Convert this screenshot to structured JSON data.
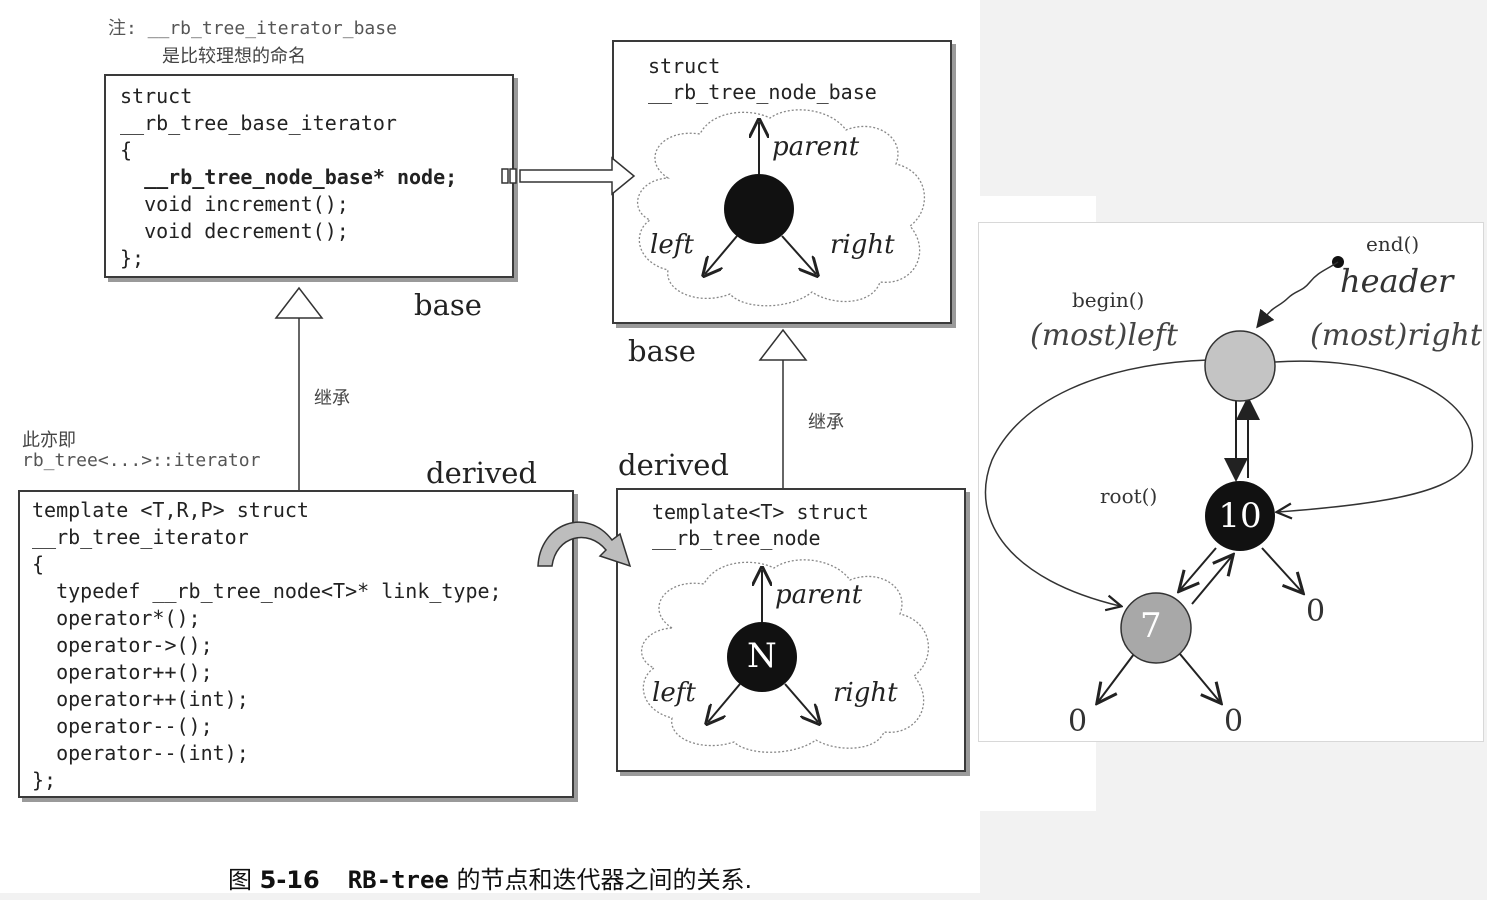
{
  "left_figure": {
    "note_line1": "注: __rb_tree_iterator_base",
    "note_line2": "是比较理想的命名",
    "base_iterator_box": {
      "lines": [
        "struct",
        "__rb_tree_base_iterator",
        "{",
        "  __rb_tree_node_base* node;",
        "  void increment();",
        "  void decrement();",
        "};"
      ]
    },
    "node_base_box": {
      "lines": [
        "struct",
        "__rb_tree_node_base"
      ],
      "parent_label": "parent",
      "left_label": "left",
      "right_label": "right"
    },
    "label_base_left": "base",
    "label_base_right": "base",
    "label_inherit_left": "继承",
    "label_inherit_right": "继承",
    "alias_line1": "此亦即",
    "alias_line2": "rb_tree<...>::iterator",
    "label_derived_left": "derived",
    "label_derived_right": "derived",
    "iterator_box": {
      "lines": [
        "template <T,R,P> struct",
        "__rb_tree_iterator",
        "{",
        "  typedef __rb_tree_node<T>* link_type;",
        "  operator*();",
        "  operator->();",
        "  operator++();",
        "  operator++(int);",
        "  operator--();",
        "  operator--(int);",
        "};"
      ]
    },
    "node_box": {
      "lines": [
        "template<T> struct",
        "__rb_tree_node"
      ],
      "node_letter": "N",
      "parent_label": "parent",
      "left_label": "left",
      "right_label": "right"
    },
    "caption_prefix": "图 ",
    "caption_number": "5-16",
    "caption_code": "RB-tree",
    "caption_text": " 的节点和迭代器之间的关系."
  },
  "right_figure": {
    "end_label": "end()",
    "header_label": "header",
    "begin_label": "begin()",
    "mostleft_label": "(most)left",
    "mostright_label": "(most)right",
    "root_label": "root()",
    "header_node_value": "",
    "root_node_value": "10",
    "left_node_value": "7",
    "null_labels": [
      "0",
      "0",
      "0"
    ],
    "colors": {
      "black_node": "#111111",
      "gray_node": "#a8a8a8",
      "header_node": "#c4c4c4"
    }
  }
}
